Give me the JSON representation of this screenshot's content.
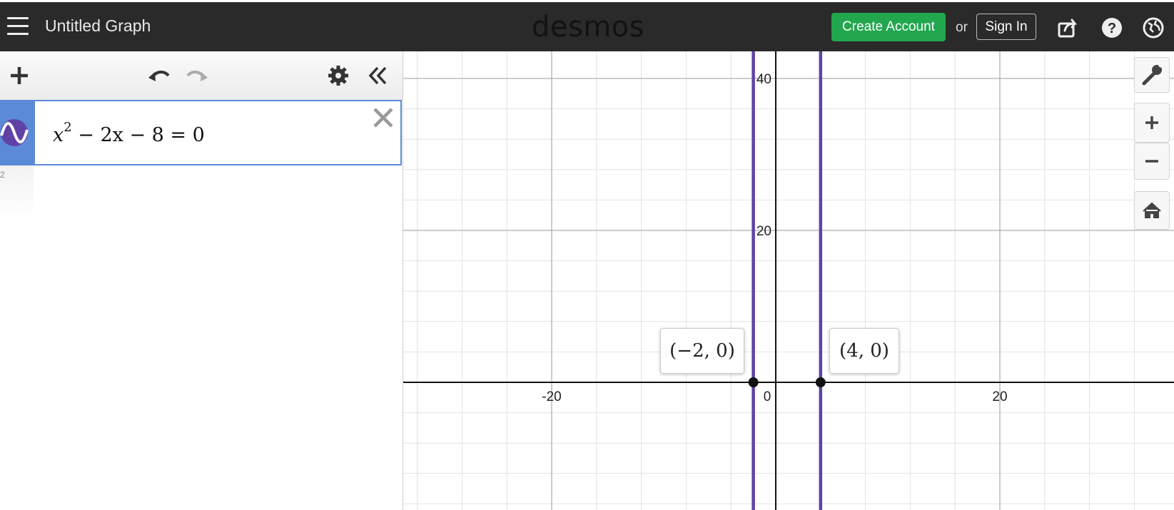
{
  "header": {
    "title": "Untitled Graph",
    "logo": "desmos",
    "create_account_label": "Create Account",
    "or_label": "or",
    "sign_in_label": "Sign In",
    "icons": [
      "menu-icon",
      "share-icon",
      "help-icon",
      "language-icon"
    ]
  },
  "sidebar": {
    "toolbar_icons": [
      "add-icon",
      "undo-icon",
      "redo-icon",
      "settings-icon",
      "collapse-icon"
    ],
    "expressions": [
      {
        "index": "1",
        "latex_parts": {
          "base": "x",
          "exp": "2",
          "rest": " − 2x − 8 = 0"
        },
        "color": "#6042a6"
      },
      {
        "index": "2"
      }
    ]
  },
  "graph": {
    "x_ticks": [
      "-20",
      "0",
      "20"
    ],
    "y_ticks": [
      "20",
      "40"
    ],
    "curve_color": "#6042a6",
    "points": [
      {
        "label": "(−2, 0)",
        "x": -2,
        "y": 0
      },
      {
        "label": "(4, 0)",
        "x": 4,
        "y": 0
      }
    ],
    "x_range": [
      -33,
      35
    ],
    "y_range": [
      -16,
      48
    ],
    "vertical_lines_x": [
      -2,
      4
    ],
    "side_icons": [
      "wrench-icon",
      "zoom-in-icon",
      "zoom-out-icon",
      "home-icon"
    ]
  },
  "colors": {
    "topbar": "#2a2a2a",
    "create_button": "#22a74f",
    "expression_accent": "#5b8ad6"
  }
}
